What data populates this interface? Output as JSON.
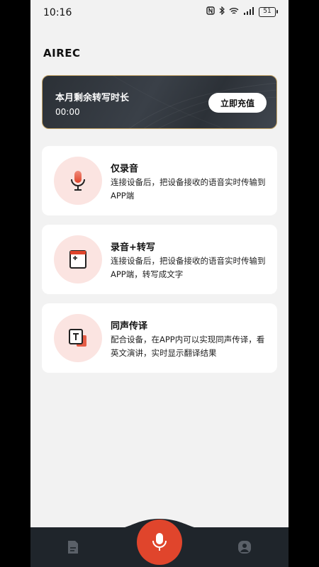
{
  "status_bar": {
    "time": "10:16",
    "battery": "51",
    "icons": [
      "nfc-icon",
      "bluetooth-icon",
      "wifi-icon",
      "signal-icon",
      "battery-icon"
    ]
  },
  "app": {
    "title": "AIREC"
  },
  "balance_card": {
    "title": "本月剩余转写时长",
    "value": "00:00",
    "button_label": "立即充值",
    "border_color": "#c9a86a"
  },
  "features": [
    {
      "title": "仅录音",
      "description": "连接设备后，把设备接收的语音实时传输到APP端",
      "icon": "microphone-icon"
    },
    {
      "title": "录音+转写",
      "description": "连接设备后，把设备接收的语音实时传输到APP端，转写成文字",
      "icon": "document-add-icon"
    },
    {
      "title": "同声传译",
      "description": "配合设备，在APP内可以实现同声传译，看英文演讲，实时显示翻译结果",
      "icon": "translate-icon"
    }
  ],
  "bottom_nav": {
    "left_icon": "file-icon",
    "center_icon": "microphone-icon",
    "right_icon": "profile-icon",
    "accent_color": "#e0452c",
    "bar_color": "#1f252b"
  }
}
